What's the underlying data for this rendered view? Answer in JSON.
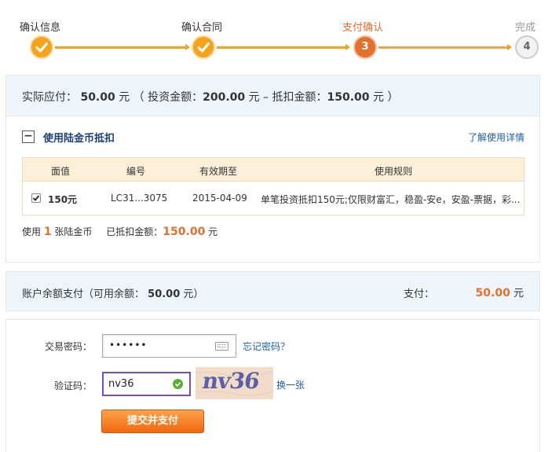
{
  "steps": [
    {
      "label": "确认信息",
      "state": "done"
    },
    {
      "label": "确认合同",
      "state": "done"
    },
    {
      "label": "支付确认",
      "state": "active",
      "number": "3"
    },
    {
      "label": "完成",
      "state": "todo",
      "number": "4"
    }
  ],
  "summary": {
    "due_label": "实际应付：",
    "due_amount": "50.00",
    "unit": "元",
    "paren_open": "（",
    "invest_label": "投资金额：",
    "invest_amount": "200.00",
    "dash": "–",
    "deduct_label": "抵扣金额：",
    "deduct_amount": "150.00",
    "paren_close": "）"
  },
  "coupon": {
    "toggle": "−",
    "title": "使用陆金币抵扣",
    "learn_more": "了解使用详情",
    "columns": [
      "面值",
      "编号",
      "有效期至",
      "使用规则"
    ],
    "rows": [
      {
        "checked": true,
        "value": "150元",
        "code": "LC31...3075",
        "expiry": "2015-04-09",
        "rule": "单笔投资抵扣150元;仅限财富汇，稳盈-安e，安盈-票据，彩..."
      }
    ],
    "used_prefix": "使用",
    "used_count": "1",
    "used_suffix": "张陆金币",
    "deducted_label": "已抵扣金额：",
    "deducted_amount": "150.00",
    "deducted_unit": "元"
  },
  "balance": {
    "label": "账户余额支付（可用余额：",
    "available": "50.00",
    "label_tail": "元）",
    "pay_label": "支付：",
    "pay_amount": "50.00",
    "pay_unit": "元"
  },
  "form": {
    "password_label": "交易密码：",
    "password_value": "••••••",
    "forgot": "忘记密码？",
    "captcha_label": "验证码：",
    "captcha_value": "nv36",
    "captcha_image_text": "nv36",
    "refresh": "换一张",
    "submit": "提交并支付"
  },
  "colors": {
    "accent": "#e3702e",
    "step_done": "#f4a31a",
    "link": "#1c5fa8",
    "panel_head": "#eef6fb"
  }
}
